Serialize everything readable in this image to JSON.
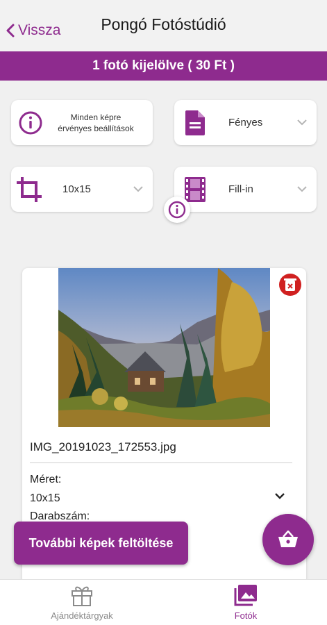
{
  "header": {
    "back_label": "Vissza",
    "title": "Pongó Fotóstúdió",
    "back_icon": "chevron-left-icon"
  },
  "banner": {
    "text": "1 fotó kijelölve ( 30 Ft )"
  },
  "settings": {
    "all_photos_label_line1": "Minden képre",
    "all_photos_label_line2": "érvényes beállítások",
    "paper_type": "Fényes",
    "size": "10x15",
    "fit_mode": "Fill-in"
  },
  "photo": {
    "filename": "IMG_20191023_172553.jpg",
    "size_label": "Méret:",
    "size_value": "10x15",
    "quantity_label": "Darabszám:"
  },
  "actions": {
    "upload_more_label": "További képek feltöltése",
    "cart_icon": "basket-icon"
  },
  "bottom_nav": {
    "items": [
      {
        "label": "Ajándéktárgyak",
        "icon": "gift-icon",
        "active": false
      },
      {
        "label": "Fotók",
        "icon": "photos-icon",
        "active": true
      }
    ]
  },
  "colors": {
    "accent": "#8e2b8e",
    "danger": "#d02020",
    "background": "#f0f0f0"
  }
}
